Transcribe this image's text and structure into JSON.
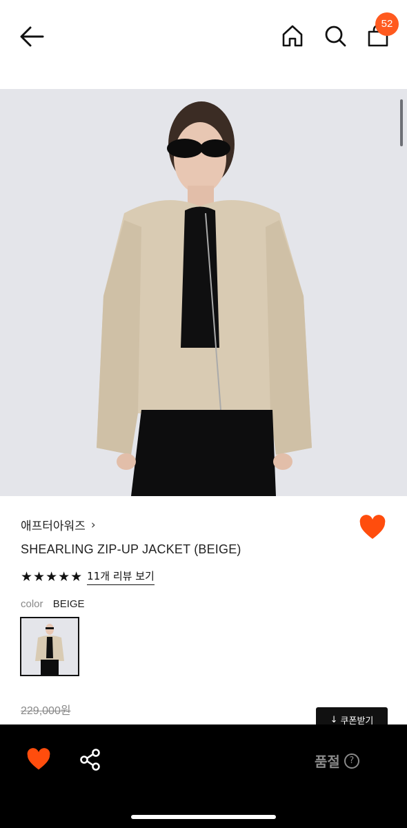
{
  "header": {
    "back_icon": "arrow-left-icon",
    "home_icon": "home-icon",
    "search_icon": "search-icon",
    "bag_icon": "shopping-bag-icon",
    "cart_count": "52",
    "badge_color": "#ff5a1f"
  },
  "product": {
    "brand": "애프터아워즈",
    "brand_chevron": "›",
    "name": "SHEARLING ZIP-UP JACKET (BEIGE)",
    "stars": "★★★★★",
    "review_link": "11개 리뷰 보기",
    "color_label": "color",
    "color_value": "BEIGE",
    "original_price": "229,000원",
    "coupon_button": "쿠폰받기",
    "coupon_arrow": "↓",
    "like_color": "#ff4d0d"
  },
  "bottom_bar": {
    "like_icon": "heart-icon",
    "share_icon": "share-icon",
    "status": "품절",
    "help": "?"
  }
}
